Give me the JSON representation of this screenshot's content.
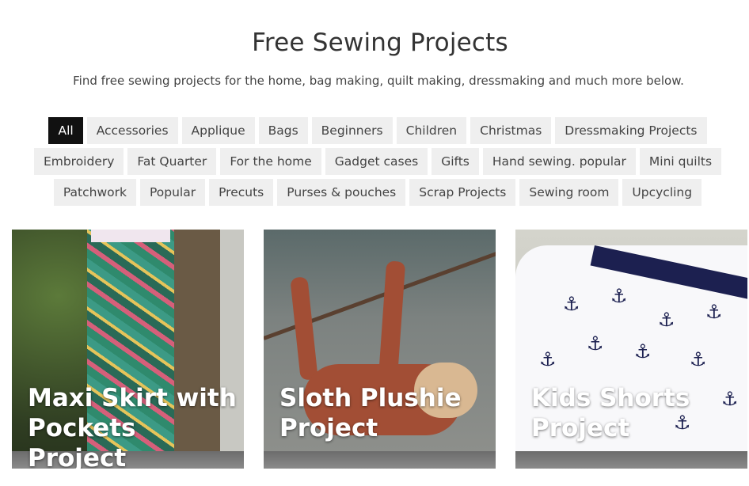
{
  "header": {
    "title": "Free Sewing Projects",
    "subtitle": "Find free sewing projects for the home, bag making, quilt making, dressmaking and much more below."
  },
  "filters": [
    "All",
    "Accessories",
    "Applique",
    "Bags",
    "Beginners",
    "Children",
    "Christmas",
    "Dressmaking Projects",
    "Embroidery",
    "Fat Quarter",
    "For the home",
    "Gadget cases",
    "Gifts",
    "Hand sewing. popular",
    "Mini quilts",
    "Patchwork",
    "Popular",
    "Precuts",
    "Purses & pouches",
    "Scrap Projects",
    "Sewing room",
    "Upcycling"
  ],
  "active_filter": "All",
  "cards": [
    {
      "title": "Maxi Skirt with Pockets Project"
    },
    {
      "title": "Sloth Plushie Project"
    },
    {
      "title": "Kids Shorts Project"
    }
  ],
  "colors": {
    "active_chip": "#111111",
    "chip_bg": "#efefef",
    "text": "#333333"
  }
}
